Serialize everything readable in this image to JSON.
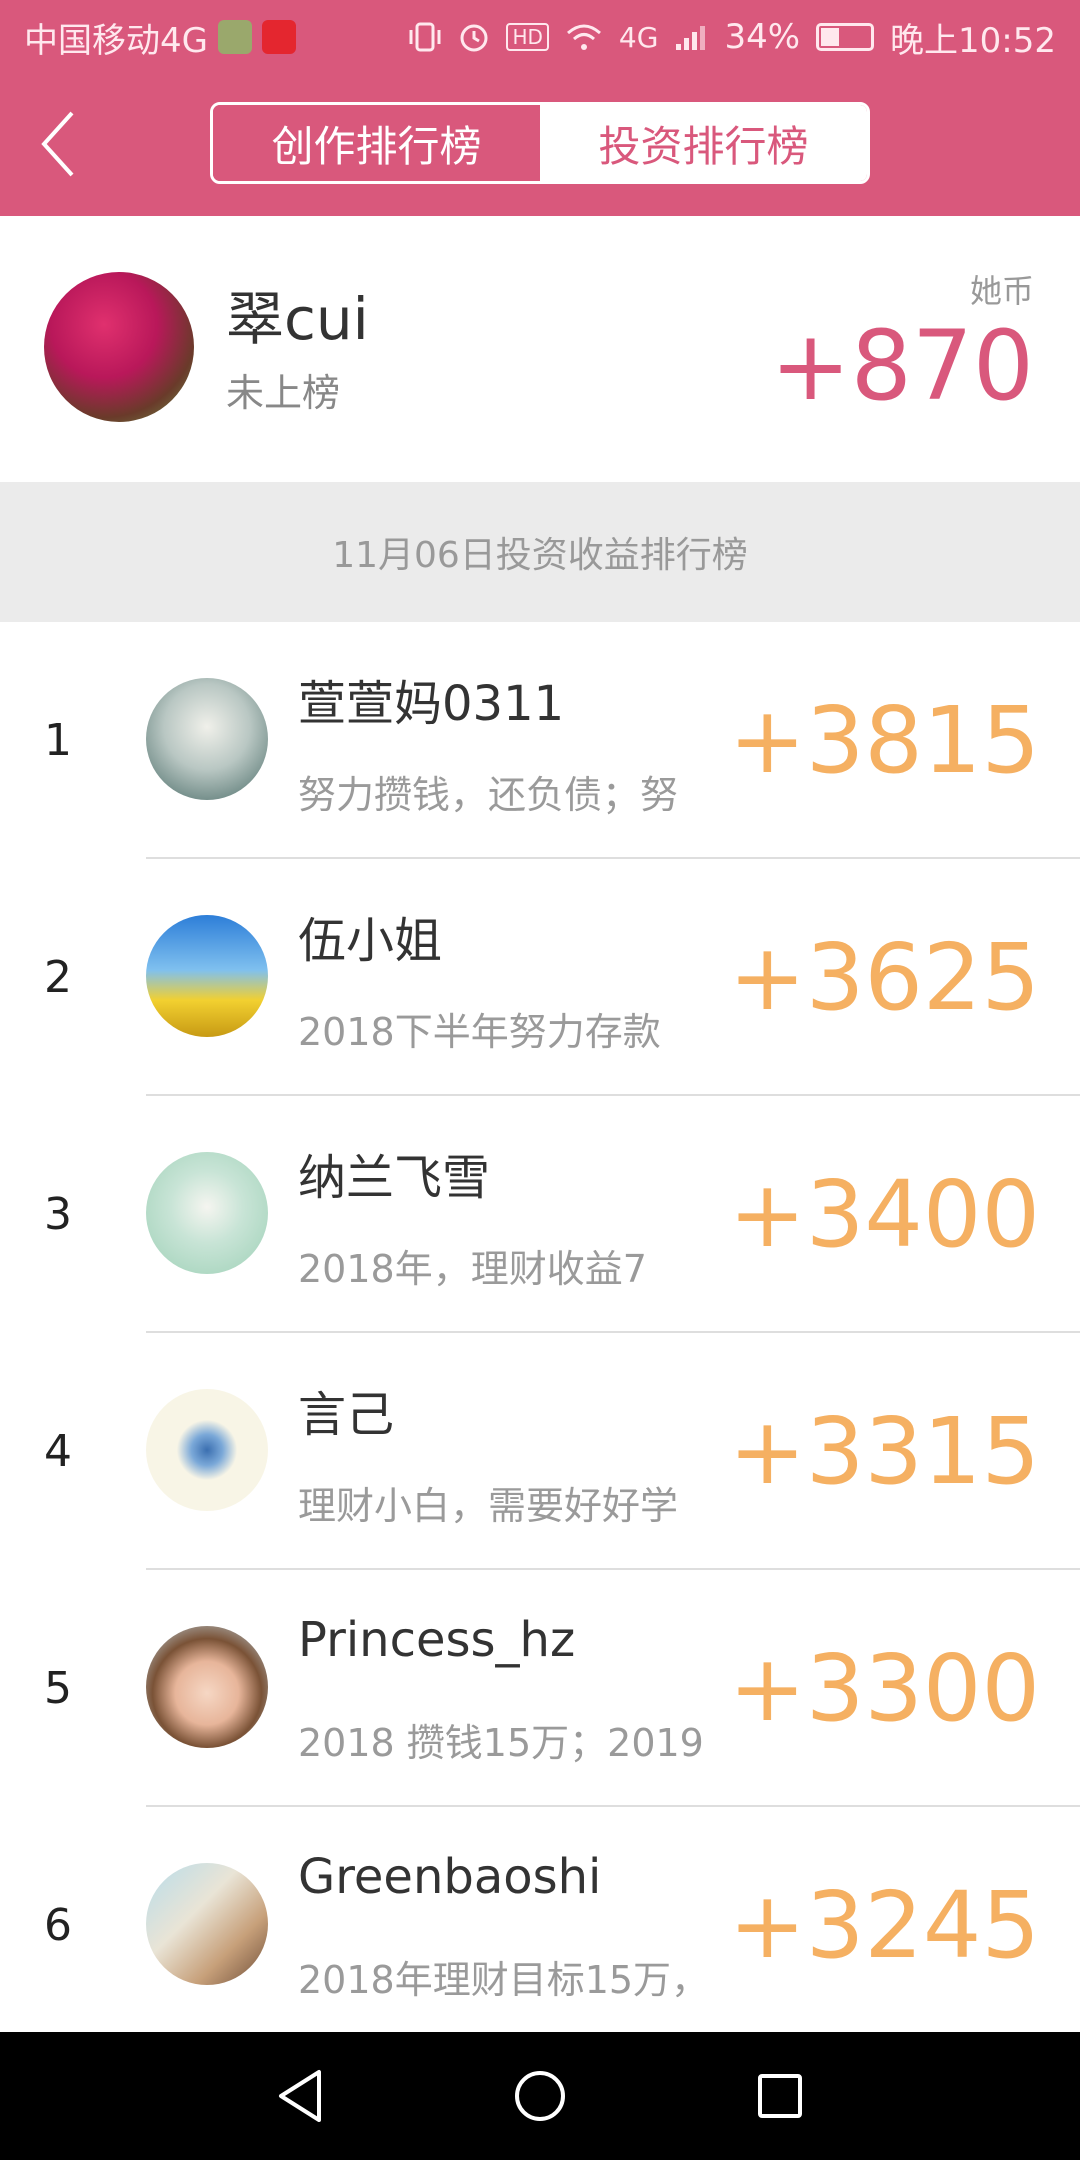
{
  "status_bar": {
    "carrier": "中国移动4G",
    "signal_label": "4G",
    "battery": "34%",
    "time": "晚上10:52",
    "hd_label": "HD",
    "icons": [
      "vibrate-icon",
      "alarm-icon",
      "hd-icon",
      "wifi-icon",
      "signal-icon",
      "battery-icon"
    ]
  },
  "header": {
    "back_icon": "back-arrow-icon",
    "tabs": [
      {
        "label": "创作排行榜",
        "active": true
      },
      {
        "label": "投资排行榜",
        "active": false
      }
    ]
  },
  "profile": {
    "name": "翠cui",
    "rank_status": "未上榜",
    "currency_label": "她币",
    "coins": "+870"
  },
  "date_label": "11月06日投资收益排行榜",
  "ranking": [
    {
      "rank": "1",
      "name": "萱萱妈0311",
      "motto": "努力攒钱，还负债；努",
      "score": "+3815"
    },
    {
      "rank": "2",
      "name": "伍小姐",
      "motto": "2018下半年努力存款",
      "score": "+3625"
    },
    {
      "rank": "3",
      "name": "纳兰飞雪",
      "motto": "2018年，理财收益7",
      "score": "+3400"
    },
    {
      "rank": "4",
      "name": "言己",
      "motto": "理财小白，需要好好学",
      "score": "+3315"
    },
    {
      "rank": "5",
      "name": "Princess_hz",
      "motto": "2018 攒钱15万；2019",
      "score": "+3300"
    },
    {
      "rank": "6",
      "name": "Greenbaoshi",
      "motto": "2018年理财目标15万，",
      "score": "+3245"
    }
  ],
  "nav_bar": [
    "back-triangle-icon",
    "home-circle-icon",
    "recents-square-icon"
  ],
  "colors": {
    "brand": "#d9587c",
    "score": "#f5b062"
  }
}
